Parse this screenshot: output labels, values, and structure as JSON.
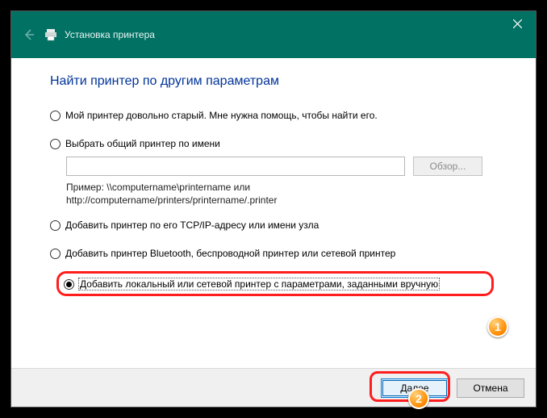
{
  "titlebar": {
    "title": "Установка принтера"
  },
  "heading": "Найти принтер по другим параметрам",
  "options": {
    "old": "Мой принтер довольно старый. Мне нужна помощь, чтобы найти его.",
    "shared": "Выбрать общий принтер по имени",
    "browse": "Обзор...",
    "example1": "Пример: \\\\computername\\printername или",
    "example2": "http://computername/printers/printername/.printer",
    "tcpip": "Добавить принтер по его TCP/IP-адресу или имени узла",
    "bluetooth": "Добавить принтер Bluetooth, беспроводной принтер или сетевой принтер",
    "local": "Добавить локальный или сетевой принтер с параметрами, заданными вручную"
  },
  "input": {
    "shared_name": ""
  },
  "footer": {
    "next": "Далее",
    "cancel": "Отмена"
  },
  "markers": {
    "one": "1",
    "two": "2"
  }
}
